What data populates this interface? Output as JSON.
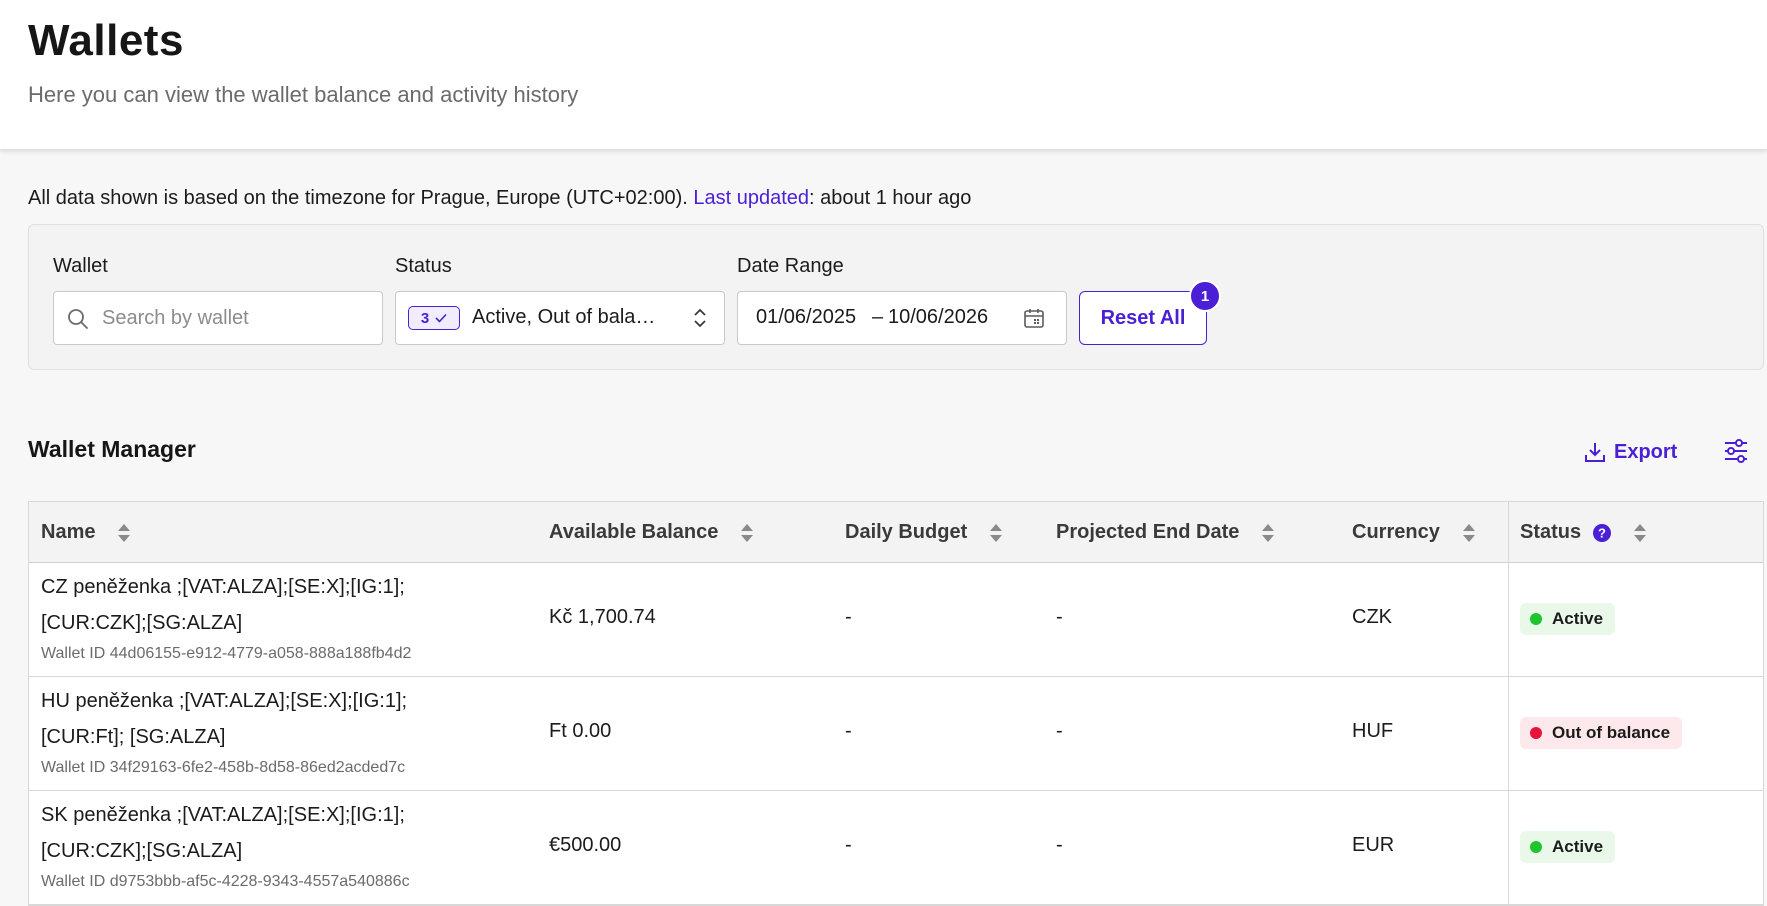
{
  "header": {
    "title": "Wallets",
    "subtitle": "Here you can view the wallet balance and activity history"
  },
  "timezone_note": {
    "prefix": "All data shown is based on the timezone for Prague, Europe (UTC+02:00). ",
    "link": "Last updated",
    "suffix": ": about 1 hour ago"
  },
  "filters": {
    "wallet": {
      "label": "Wallet",
      "placeholder": "Search by wallet",
      "value": ""
    },
    "status": {
      "label": "Status",
      "count": "3",
      "value": "Active, Out of bala…"
    },
    "date_range": {
      "label": "Date Range",
      "start": "01/06/2025",
      "separator": "–",
      "end": "10/06/2026"
    },
    "reset": {
      "label": "Reset All",
      "badge": "1"
    }
  },
  "manager": {
    "title": "Wallet Manager",
    "export_label": "Export"
  },
  "table": {
    "columns": [
      "Name",
      "Available Balance",
      "Daily Budget",
      "Projected End Date",
      "Currency",
      "Status"
    ],
    "rows": [
      {
        "name": "CZ peněženka ;[VAT:ALZA];[SE:X];[IG:1]; [CUR:CZK];[SG:ALZA]",
        "wallet_id": "Wallet ID 44d06155-e912-4779-a058-888a188fb4d2",
        "balance": "Kč 1,700.74",
        "daily_budget": "-",
        "end_date": "-",
        "currency": "CZK",
        "status": "Active"
      },
      {
        "name": "HU peněženka ;[VAT:ALZA];[SE:X];[IG:1];[CUR:Ft]; [SG:ALZA]",
        "wallet_id": "Wallet ID 34f29163-6fe2-458b-8d58-86ed2acded7c",
        "balance": "Ft 0.00",
        "daily_budget": "-",
        "end_date": "-",
        "currency": "HUF",
        "status": "Out of balance"
      },
      {
        "name": "SK peněženka ;[VAT:ALZA];[SE:X];[IG:1]; [CUR:CZK];[SG:ALZA]",
        "wallet_id": "Wallet ID d9753bbb-af5c-4228-9343-4557a540886c",
        "balance": "€500.00",
        "daily_budget": "-",
        "end_date": "-",
        "currency": "EUR",
        "status": "Active"
      }
    ]
  },
  "colors": {
    "accent": "#4a1fd6",
    "active_dot": "#1fc42e",
    "active_bg": "#eaf8ea",
    "out_dot": "#e8123b",
    "out_bg": "#fde8ec"
  }
}
